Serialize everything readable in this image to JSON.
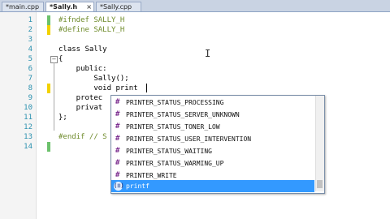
{
  "tabs": [
    {
      "label": "*main.cpp",
      "active": false
    },
    {
      "label": "*Sally.h",
      "active": true
    },
    {
      "label": "*Sally.cpp",
      "active": false
    }
  ],
  "lines": [
    {
      "num": "1",
      "text": "#ifndef SALLY_H"
    },
    {
      "num": "2",
      "text": "#define SALLY_H"
    },
    {
      "num": "3",
      "text": ""
    },
    {
      "num": "4",
      "text": "class Sally"
    },
    {
      "num": "5",
      "text": "{"
    },
    {
      "num": "6",
      "text": "    public:"
    },
    {
      "num": "7",
      "text": "        Sally();"
    },
    {
      "num": "8",
      "text": "        void print"
    },
    {
      "num": "9",
      "text": "    protec"
    },
    {
      "num": "10",
      "text": "    privat"
    },
    {
      "num": "11",
      "text": "};"
    },
    {
      "num": "12",
      "text": ""
    },
    {
      "num": "13",
      "text": "#endif // S"
    },
    {
      "num": "14",
      "text": ""
    }
  ],
  "autocomplete": {
    "items": [
      {
        "label": "PRINTER_STATUS_PROCESSING",
        "icon": "macro-icon"
      },
      {
        "label": "PRINTER_STATUS_SERVER_UNKNOWN",
        "icon": "macro-icon"
      },
      {
        "label": "PRINTER_STATUS_TONER_LOW",
        "icon": "macro-icon"
      },
      {
        "label": "PRINTER_STATUS_USER_INTERVENTION",
        "icon": "macro-icon"
      },
      {
        "label": "PRINTER_STATUS_WAITING",
        "icon": "macro-icon"
      },
      {
        "label": "PRINTER_STATUS_WARMING_UP",
        "icon": "macro-icon"
      },
      {
        "label": "PRINTER_WRITE",
        "icon": "macro-icon"
      },
      {
        "label": "printf",
        "icon": "function-icon",
        "selected": true
      }
    ]
  },
  "glyphs": {
    "macro": "#",
    "function": "(≡)",
    "fold_open": "−"
  },
  "colors": {
    "line_numbers": "#2b91af",
    "preprocessor": "#6f8b2b",
    "selection": "#3399ff",
    "change_marker": "#f2d100",
    "saved_marker": "#6cc16c"
  }
}
